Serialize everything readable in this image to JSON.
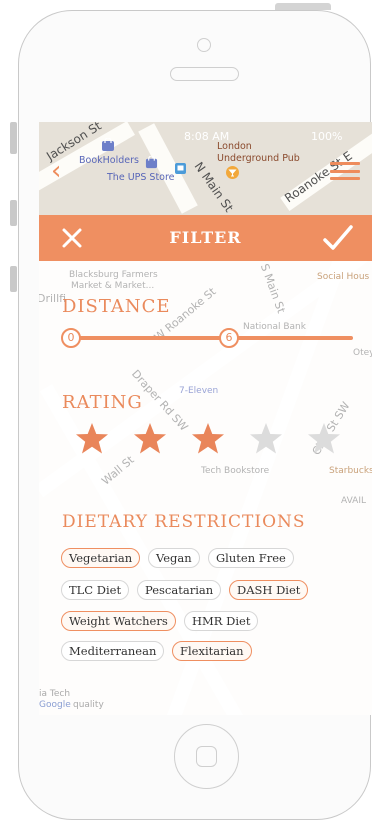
{
  "map": {
    "status_time": "8:08 AM",
    "status_battery": "100%",
    "streets": [
      "Jackson St",
      "N Main St",
      "Roanoke St E"
    ],
    "pois": [
      "BookHolders",
      "The UPS Store",
      "London",
      "Underground Pub"
    ]
  },
  "filter": {
    "title": "FILTER"
  },
  "background_map": {
    "labels": [
      "Blacksburg Farmers",
      "Market & Market...",
      "Social Hous",
      "W Roanoke St",
      "S Main St",
      "National Bank",
      "7-Eleven",
      "Draper Rd SW",
      "Tech Bookstore",
      "Starbucks",
      "AVAIL",
      "Clay St SW",
      "Wall St",
      "Otey",
      "Drillfi"
    ],
    "footer_labels": [
      "ia Tech",
      "Google",
      "quality"
    ]
  },
  "distance": {
    "label": "DISTANCE",
    "min_label": "0",
    "value_label": "6",
    "value_fraction": 0.58
  },
  "rating": {
    "label": "RATING",
    "value": 3,
    "max": 5
  },
  "dietary": {
    "label": "DIETARY RESTRICTIONS",
    "tags": [
      {
        "label": "Vegetarian",
        "selected": true
      },
      {
        "label": "Vegan",
        "selected": false
      },
      {
        "label": "Gluten Free",
        "selected": false
      },
      {
        "label": "TLC Diet",
        "selected": false
      },
      {
        "label": "Pescatarian",
        "selected": false
      },
      {
        "label": "DASH Diet",
        "selected": true
      },
      {
        "label": "Weight Watchers",
        "selected": true
      },
      {
        "label": "HMR Diet",
        "selected": false
      },
      {
        "label": "Mediterranean",
        "selected": false
      },
      {
        "label": "Flexitarian",
        "selected": true
      }
    ]
  },
  "colors": {
    "accent": "#ef8f61",
    "star_on": "#e9855a",
    "star_off": "#dcdcdc",
    "selected_border": "#ef8f61",
    "unselected_border": "#d7d7d7"
  },
  "icons": {
    "close": "close-icon",
    "confirm": "checkmark-icon",
    "back": "chevron-left-icon",
    "menu": "hamburger-menu-icon",
    "star": "star-icon",
    "shopping_bag": "shopping-bag-icon",
    "bus_stop": "bus-stop-icon",
    "cocktail": "cocktail-icon"
  }
}
